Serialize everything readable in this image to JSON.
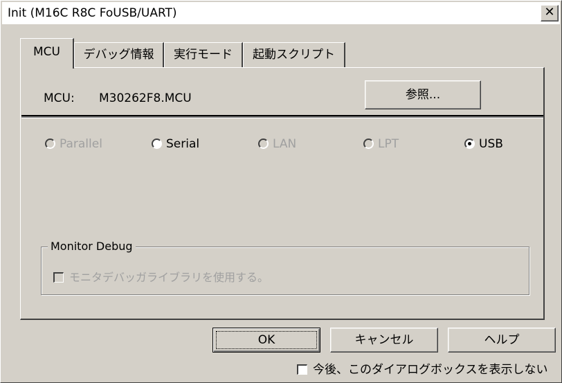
{
  "window": {
    "title": "Init (M16C R8C FoUSB/UART)",
    "close_glyph": "✕"
  },
  "tabs": [
    {
      "label": "MCU",
      "active": true
    },
    {
      "label": "デバッグ情報",
      "active": false
    },
    {
      "label": "実行モード",
      "active": false
    },
    {
      "label": "起動スクリプト",
      "active": false
    }
  ],
  "mcu": {
    "label": "MCU:",
    "value": "M30262F8.MCU",
    "browse_label": "参照..."
  },
  "connection": {
    "options": [
      {
        "label": "Parallel",
        "enabled": false,
        "selected": false
      },
      {
        "label": "Serial",
        "enabled": true,
        "selected": false
      },
      {
        "label": "LAN",
        "enabled": false,
        "selected": false
      },
      {
        "label": "LPT",
        "enabled": false,
        "selected": false
      },
      {
        "label": "USB",
        "enabled": true,
        "selected": true
      }
    ]
  },
  "monitor_debug": {
    "title": "Monitor Debug",
    "checkbox_label": "モニタデバッガライブラリを使用する。",
    "checked": false,
    "enabled": false
  },
  "buttons": {
    "ok": "OK",
    "cancel": "キャンセル",
    "help": "ヘルプ"
  },
  "footer": {
    "dont_show_label": "今後、このダイアログボックスを表示しない",
    "checked": false
  },
  "colors": {
    "face": "#d4d0c8",
    "disabled_text": "#a0a0a0"
  }
}
